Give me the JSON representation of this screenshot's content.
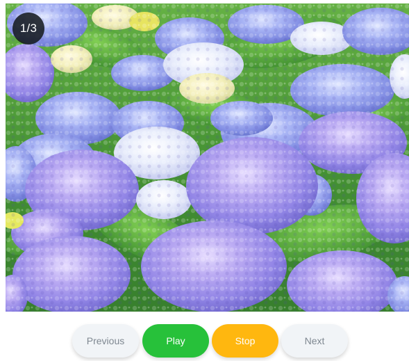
{
  "slideshow": {
    "counter": "1/3",
    "image": {
      "subject": "hydrangea-flowers-photo"
    }
  },
  "controls": {
    "previous_label": "Previous",
    "play_label": "Play",
    "stop_label": "Stop",
    "next_label": "Next"
  },
  "colors": {
    "play": "#27c13a",
    "stop": "#ffb70f",
    "neutral_button": "#f1f4f7",
    "neutral_text": "#7f8891",
    "badge": "#14181c"
  }
}
